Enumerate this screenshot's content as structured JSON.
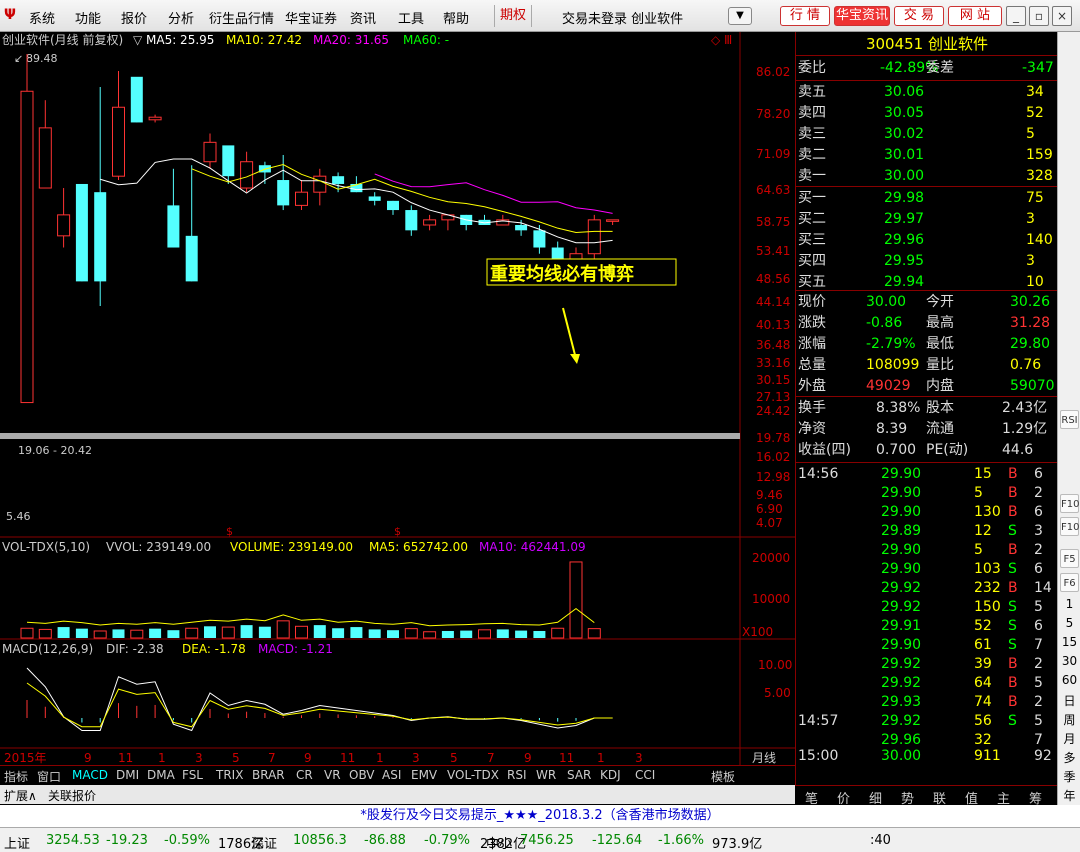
{
  "menu": {
    "items": [
      "系统",
      "功能",
      "报价",
      "分析",
      "衍生品行情",
      "华宝证券",
      "资讯",
      "工具",
      "帮助"
    ],
    "qihuo": "期权",
    "status": "交易未登录  创业软件",
    "buttons": [
      "行 情",
      "华宝资讯",
      "交 易",
      "网 站"
    ]
  },
  "chart": {
    "header": "创业软件(月线 前复权)",
    "ma": [
      {
        "label": "MA5: 25.95",
        "color": "#ffffff"
      },
      {
        "label": "MA10: 27.42",
        "color": "#ffff00"
      },
      {
        "label": "MA20: 31.65",
        "color": "#ff00ff"
      },
      {
        "label": "MA60: -",
        "color": "#00ff00"
      }
    ],
    "price_axis": [
      "86.02",
      "78.20",
      "71.09",
      "64.63",
      "58.75",
      "53.41",
      "48.56",
      "44.14",
      "40.13",
      "36.48",
      "33.16",
      "30.15",
      "27.13",
      "24.42",
      "19.78",
      "16.02",
      "12.98",
      "9.46",
      "6.90",
      "4.07"
    ],
    "high_label": "89.48",
    "low_label": "5.46",
    "range_label": "19.06 - 20.42",
    "annotation": "重要均线必有博弈",
    "candles": [
      [
        9,
        70,
        88,
        9,
        89.5
      ],
      [
        37,
        55,
        65,
        38,
        66
      ],
      [
        27,
        31,
        36,
        25,
        37
      ],
      [
        38,
        20,
        25,
        33,
        22
      ],
      [
        36,
        20,
        36,
        17,
        72
      ],
      [
        40,
        63,
        78,
        39,
        80
      ],
      [
        77,
        57,
        75,
        57,
        76
      ],
      [
        58,
        59,
        58,
        57,
        60
      ],
      [
        33,
        25,
        40,
        25,
        42
      ],
      [
        27,
        20,
        40,
        24,
        43
      ],
      [
        44,
        50,
        50,
        42,
        53
      ],
      [
        49,
        40,
        42,
        38,
        48
      ],
      [
        37,
        44,
        44,
        36,
        47
      ],
      [
        43,
        41,
        42,
        38,
        44
      ],
      [
        39,
        33,
        38,
        32,
        46
      ],
      [
        33,
        36,
        38,
        32,
        39
      ],
      [
        36,
        40,
        36,
        33,
        42
      ],
      [
        40,
        38,
        41,
        36,
        41
      ],
      [
        38,
        36,
        39,
        36,
        40
      ],
      [
        35,
        34,
        33,
        33,
        36
      ],
      [
        34,
        32,
        33,
        31,
        34
      ],
      [
        32,
        28,
        29,
        27,
        33
      ],
      [
        29,
        30,
        29,
        28,
        31
      ],
      [
        30,
        31,
        31,
        28,
        31
      ],
      [
        31,
        29,
        30,
        28,
        31
      ],
      [
        30,
        29,
        30,
        29,
        31
      ],
      [
        29,
        30,
        29,
        29,
        31
      ],
      [
        29,
        28,
        29,
        27,
        30
      ],
      [
        28,
        25,
        28,
        24,
        29
      ],
      [
        25,
        22,
        25,
        22,
        26
      ],
      [
        23,
        24,
        24,
        23,
        25
      ],
      [
        24,
        30,
        30,
        22,
        31
      ],
      [
        30,
        30,
        30,
        29,
        30
      ]
    ],
    "x_labels": [
      "2015年",
      "9",
      "11",
      "1",
      "3",
      "5",
      "7",
      "9",
      "11",
      "1",
      "3",
      "5",
      "7",
      "9",
      "11",
      "1",
      "3"
    ],
    "period": "月线",
    "vol_header": {
      "name": "VOL-TDX(5,10)",
      "vvol": "VVOL: 239149.00",
      "volume": "VOLUME: 239149.00",
      "ma5": "MA5: 652742.00",
      "ma10": "MA10: 462441.09"
    },
    "vol_axis": [
      "20000",
      "10000",
      "X100"
    ],
    "volumes": [
      2.5,
      2.2,
      2.8,
      2.4,
      1.8,
      2.2,
      2.0,
      2.4,
      2.0,
      2.5,
      3.0,
      2.8,
      3.3,
      2.9,
      4.4,
      3.0,
      3.3,
      2.5,
      2.8,
      2.2,
      2.0,
      2.4,
      1.6,
      1.8,
      1.9,
      2.1,
      2.2,
      1.9,
      1.8,
      2.5,
      19.5,
      2.4
    ],
    "macd_header": {
      "name": "MACD(12,26,9)",
      "dif": "DIF: -2.38",
      "dea": "DEA: -1.78",
      "macd": "MACD: -1.21"
    },
    "macd_axis": [
      "10.00",
      "5.00"
    ]
  },
  "quote": {
    "code": "300451",
    "name": "创业软件",
    "weibi": {
      "label": "委比",
      "pct": "-42.89%",
      "label2": "委差",
      "val": "-347"
    },
    "sells": [
      [
        "卖五",
        "30.06",
        "34"
      ],
      [
        "卖四",
        "30.05",
        "52"
      ],
      [
        "卖三",
        "30.02",
        "5"
      ],
      [
        "卖二",
        "30.01",
        "159"
      ],
      [
        "卖一",
        "30.00",
        "328"
      ]
    ],
    "buys": [
      [
        "买一",
        "29.98",
        "75"
      ],
      [
        "买二",
        "29.97",
        "3"
      ],
      [
        "买三",
        "29.96",
        "140"
      ],
      [
        "买四",
        "29.95",
        "3"
      ],
      [
        "买五",
        "29.94",
        "10"
      ]
    ],
    "stats": [
      [
        "现价",
        "30.00",
        "今开",
        "30.26"
      ],
      [
        "涨跌",
        "-0.86",
        "最高",
        "31.28"
      ],
      [
        "涨幅",
        "-2.79%",
        "最低",
        "29.80"
      ],
      [
        "总量",
        "108099",
        "量比",
        "0.76"
      ],
      [
        "外盘",
        "49029",
        "内盘",
        "59070"
      ]
    ],
    "stats2": [
      [
        "换手",
        "8.38%",
        "股本",
        "2.43亿"
      ],
      [
        "净资",
        "8.39",
        "流通",
        "1.29亿"
      ],
      [
        "收益(四)",
        "0.700",
        "PE(动)",
        "44.6"
      ]
    ],
    "ticks": [
      [
        "14:56",
        "29.90",
        "15",
        "B",
        "6"
      ],
      [
        "",
        "29.90",
        "5",
        "B",
        "2"
      ],
      [
        "",
        "29.90",
        "130",
        "B",
        "6"
      ],
      [
        "",
        "29.89",
        "12",
        "S",
        "3"
      ],
      [
        "",
        "29.90",
        "5",
        "B",
        "2"
      ],
      [
        "",
        "29.90",
        "103",
        "S",
        "6"
      ],
      [
        "",
        "29.92",
        "232",
        "B",
        "14"
      ],
      [
        "",
        "29.92",
        "150",
        "S",
        "5"
      ],
      [
        "",
        "29.91",
        "52",
        "S",
        "6"
      ],
      [
        "",
        "29.90",
        "61",
        "S",
        "7"
      ],
      [
        "",
        "29.92",
        "39",
        "B",
        "2"
      ],
      [
        "",
        "29.92",
        "64",
        "B",
        "5"
      ],
      [
        "",
        "29.93",
        "74",
        "B",
        "2"
      ],
      [
        "14:57",
        "29.92",
        "56",
        "S",
        "5"
      ],
      [
        "",
        "29.96",
        "32",
        "",
        "7"
      ],
      [
        "15:00",
        "30.00",
        "911",
        "",
        "92"
      ]
    ],
    "tabs": [
      "笔",
      "价",
      "细",
      "势",
      "联",
      "值",
      "主",
      "筹"
    ]
  },
  "tabs": [
    "指标",
    "窗口",
    "MACD",
    "DMI",
    "DMA",
    "FSL",
    "TRIX",
    "BRAR",
    "CR",
    "VR",
    "OBV",
    "ASI",
    "EMV",
    "VOL-TDX",
    "RSI",
    "WR",
    "SAR",
    "KDJ",
    "CCI"
  ],
  "tabs_right": "模板",
  "expand": [
    "扩展∧",
    "关联报价"
  ],
  "ticker": "*股发行及今日交易提示_★★★_2018.3.2（含香港市场数据）",
  "indices": [
    {
      "name": "上证",
      "val": "3254.53",
      "chg": "-19.23",
      "pct": "-0.59%",
      "amt": "1786亿"
    },
    {
      "name": "深证",
      "val": "10856.3",
      "chg": "-86.88",
      "pct": "-0.79%",
      "amt": "2382亿"
    },
    {
      "name": "中小",
      "val": "7456.25",
      "chg": "-125.64",
      "pct": "-1.66%",
      "amt": "973.9亿"
    }
  ],
  "index_extra": ":40",
  "sidebar": [
    "RSI",
    "F10",
    "F5",
    "F6",
    "F10",
    "1",
    "5",
    "15",
    "30",
    "60",
    "日",
    "周",
    "月",
    "多",
    "季",
    "年"
  ]
}
